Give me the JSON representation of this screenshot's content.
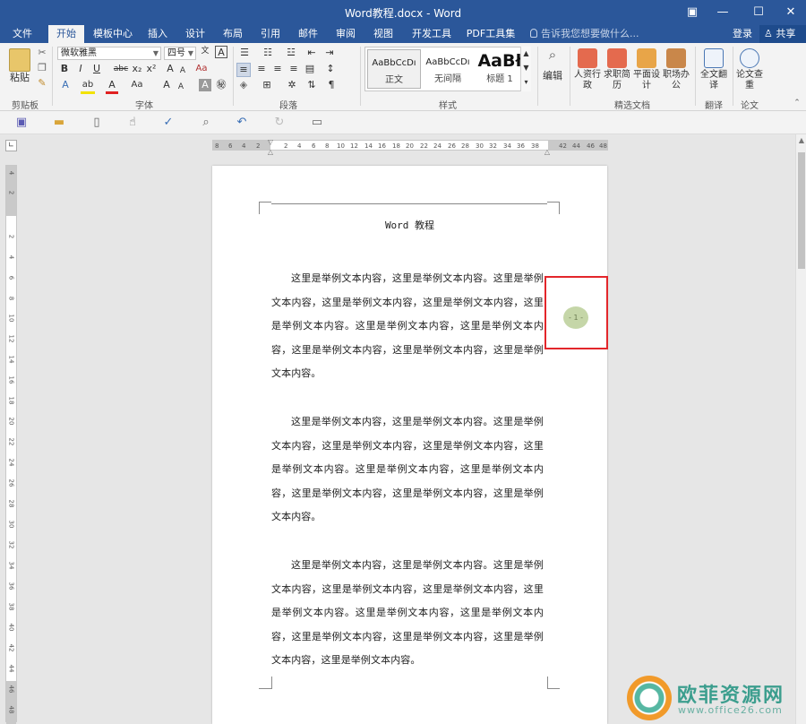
{
  "window": {
    "title": "Word教程.docx - Word",
    "controls": {
      "ribbon_display": "▣",
      "minimize": "—",
      "maximize": "☐",
      "close": "✕"
    }
  },
  "tabs": [
    "文件",
    "开始",
    "模板中心",
    "插入",
    "设计",
    "布局",
    "引用",
    "邮件",
    "审阅",
    "视图",
    "开发工具",
    "PDF工具集"
  ],
  "active_tab": "开始",
  "tell_me": "告诉我您想要做什么...",
  "account": {
    "login": "登录",
    "share": "共享"
  },
  "ribbon": {
    "clipboard": {
      "paste": "粘贴",
      "group": "剪贴板"
    },
    "font": {
      "name": "微软雅黑",
      "size": "四号",
      "wen": "文",
      "grow": "A",
      "shrink": "A",
      "clear_format": "Aa",
      "char_border": "A",
      "bold": "B",
      "italic": "I",
      "underline": "U",
      "strike": "abc",
      "subscript": "x₂",
      "superscript": "x²",
      "effects": "A",
      "highlight": "ab",
      "font_color": "A",
      "change_case": "Aa",
      "grow2": "A",
      "shrink2": "A",
      "shade": "A",
      "enclose": "㊙",
      "group": "字体"
    },
    "paragraph": {
      "group": "段落"
    },
    "styles": {
      "items": [
        {
          "preview": "AaBbCcDı",
          "name": "正文"
        },
        {
          "preview": "AaBbCcDı",
          "name": "无间隔"
        },
        {
          "preview": "AaBł",
          "name": "标题 1"
        }
      ],
      "group": "样式"
    },
    "editing": {
      "label": "编辑"
    },
    "templates": {
      "items": [
        "人资行政",
        "求职简历",
        "平面设计",
        "职场办公"
      ],
      "group": "精选文档"
    },
    "translate": {
      "label": "全文翻译",
      "group": "翻译"
    },
    "thesis": {
      "label": "论文查重",
      "group": "论文"
    }
  },
  "qat": [
    "save-icon",
    "open-icon",
    "new-icon",
    "touch-mode-icon",
    "spelling-icon",
    "print-preview-icon",
    "undo-icon",
    "redo-icon",
    "window-icon"
  ],
  "ruler": {
    "h_labels": "8   6   4   2      2   4   6   8  10  12  14  16  18  20  22  24  26  28  30  32  34  36  38      42  44  46  48",
    "v_labels": [
      "4",
      "2",
      "",
      "2",
      "4",
      "6",
      "8",
      "10",
      "12",
      "14",
      "16",
      "18",
      "20",
      "22",
      "24",
      "26",
      "28",
      "30",
      "32",
      "34",
      "36",
      "38",
      "40",
      "42",
      "44",
      "46",
      "48"
    ]
  },
  "document": {
    "header": "Word 教程",
    "paragraphs": [
      "这里是举例文本内容，这里是举例文本内容。这里是举例文本内容，这里是举例文本内容，这里是举例文本内容，这里是举例文本内容。这里是举例文本内容，这里是举例文本内容，这里是举例文本内容，这里是举例文本内容，这里是举例文本内容。",
      "这里是举例文本内容，这里是举例文本内容。这里是举例文本内容，这里是举例文本内容，这里是举例文本内容，这里是举例文本内容。这里是举例文本内容，这里是举例文本内容，这里是举例文本内容，这里是举例文本内容，这里是举例文本内容。",
      "这里是举例文本内容，这里是举例文本内容。这里是举例文本内容，这里是举例文本内容，这里是举例文本内容，这里是举例文本内容。这里是举例文本内容，这里是举例文本内容，这里是举例文本内容，这里是举例文本内容，这里是举例文本内容，这里是举例文本内容。"
    ]
  },
  "page_number_marker": "- 1 -",
  "watermark": {
    "name": "欧菲资源网",
    "url": "www.office26.com"
  },
  "colors": {
    "accent": "#2b579a",
    "highlight_box": "#e3262b",
    "marker": "#c5d6a8"
  }
}
